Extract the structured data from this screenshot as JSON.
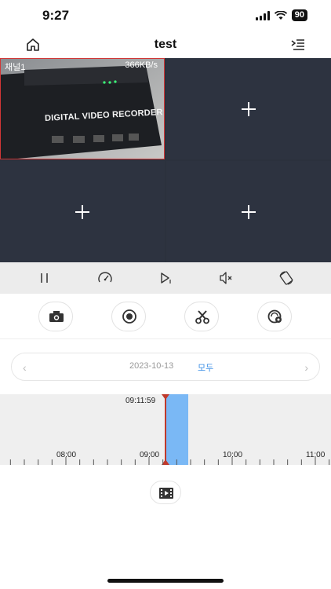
{
  "status": {
    "time": "9:27",
    "battery": "90"
  },
  "nav": {
    "title": "test",
    "home_icon": "home-icon",
    "menu_icon": "menu-list-icon"
  },
  "grid": {
    "channel_label": "채널1",
    "bitrate": "366KB/s",
    "device_text": "DIGITAL VIDEO RECORDER",
    "empty_icon": "plus-icon"
  },
  "controls": [
    "pause-icon",
    "speed-gauge-icon",
    "next-frame-icon",
    "mute-icon",
    "rotate-icon"
  ],
  "actions": [
    "camera-icon",
    "record-icon",
    "scissors-icon",
    "sync-icon"
  ],
  "date": {
    "value": "2023-10-13",
    "all_label": "모두"
  },
  "timeline": {
    "current_time": "09:11:59",
    "labels": [
      "08:00",
      "09:00",
      "10:00",
      "11:00"
    ],
    "accent": "#7ab8f5",
    "cursor_color": "#c0392b"
  },
  "clip_icon": "video-clip-icon"
}
